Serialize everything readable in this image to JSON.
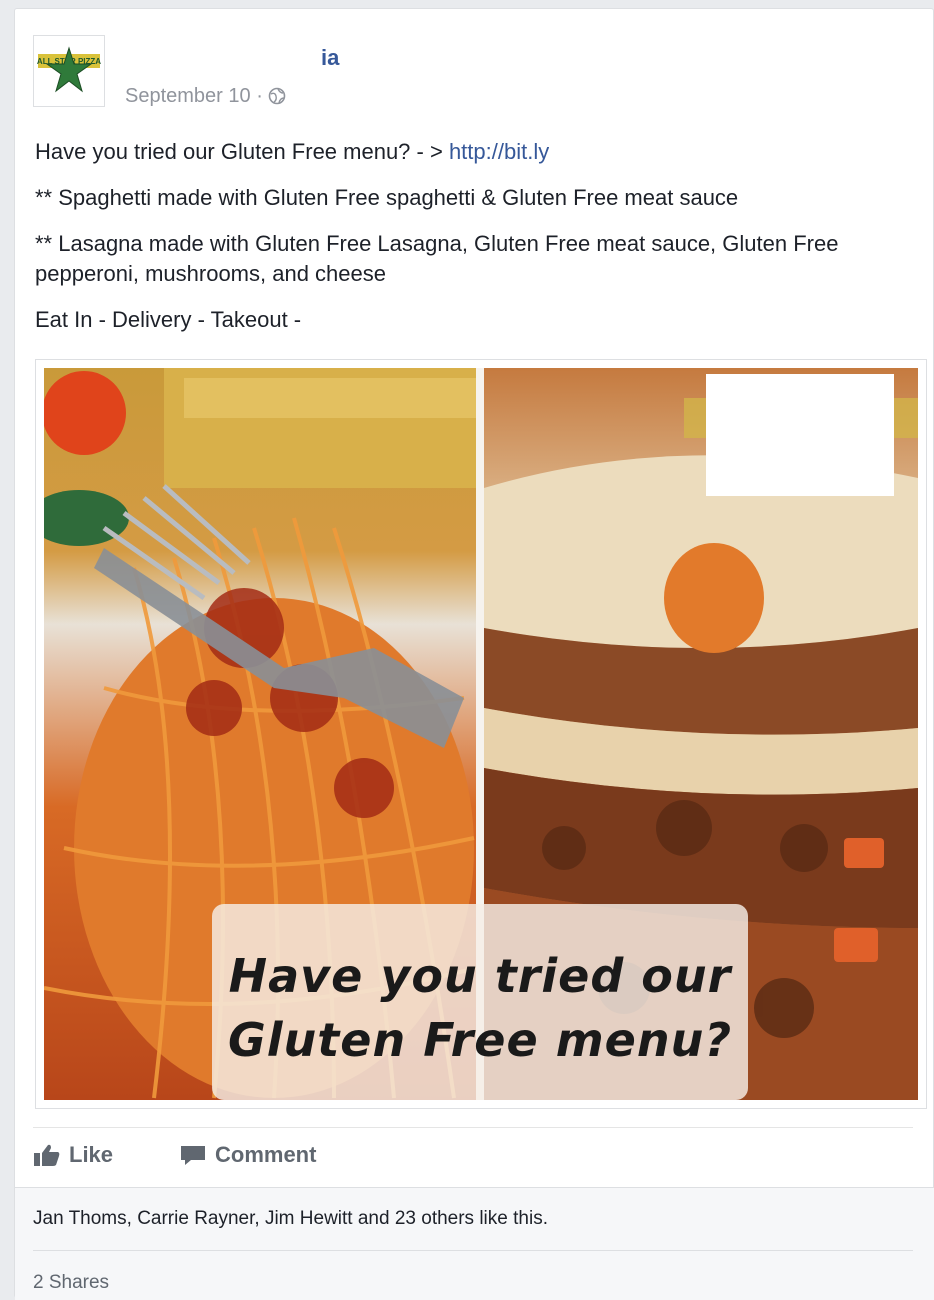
{
  "post": {
    "page_name": "ia",
    "timestamp": "September 10 · ",
    "lines": {
      "line1_text": "Have you tried our Gluten Free menu? - > ",
      "line1_link": "http://bit.ly",
      "line2": "** Spaghetti made with Gluten Free spaghetti & Gluten Free meat sauce",
      "line3": "** Lasagna made with Gluten Free Lasagna, Gluten Free meat sauce, Gluten Free pepperoni, mushrooms, and cheese",
      "line4": "Eat In - Delivery - Takeout - "
    },
    "image_caption_line1": "Have you tried our",
    "image_caption_line2": "Gluten Free menu?"
  },
  "actions": {
    "like_label": "Like",
    "comment_label": "Comment"
  },
  "engagement": {
    "likes_text": "Jan Thoms, Carrie Rayner, Jim Hewitt and 23 others like this.",
    "shares_text": "2 Shares"
  },
  "colors": {
    "link": "#365899",
    "muted": "#90949c",
    "action": "#606770"
  },
  "icons": [
    "star-logo-icon",
    "globe-icon",
    "like-thumb-icon",
    "comment-icon"
  ]
}
